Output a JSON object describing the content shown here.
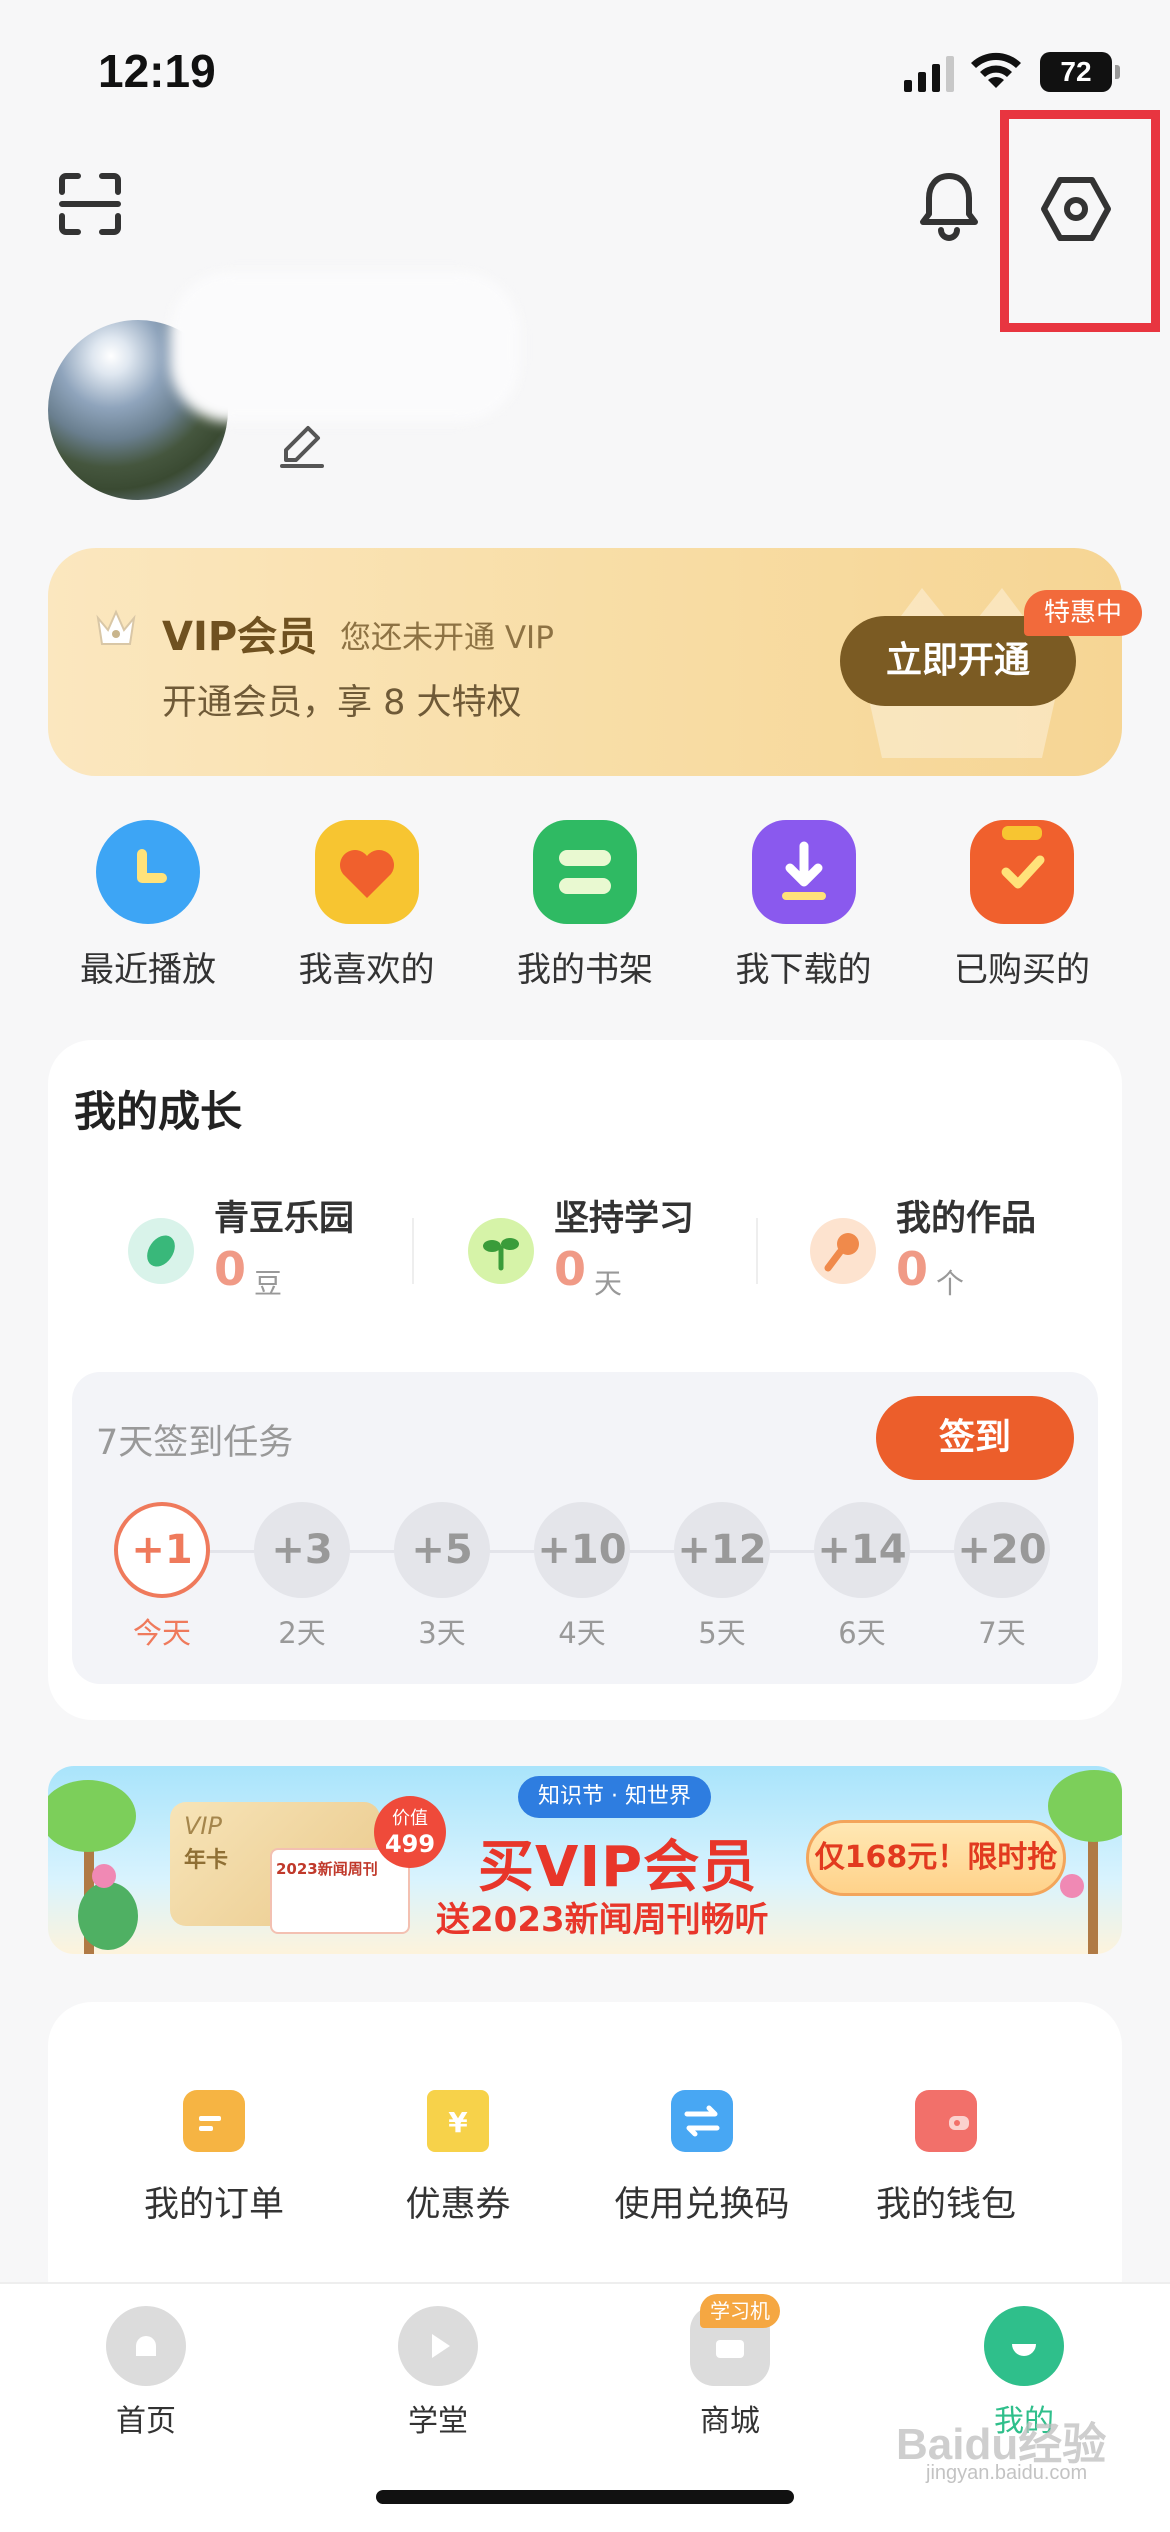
{
  "status_bar": {
    "time": "12:19",
    "battery": "72"
  },
  "profile": {
    "name": ""
  },
  "vip": {
    "title": "VIP会员",
    "subtitle": "您还未开通 VIP",
    "description": "开通会员，享 8 大特权",
    "button": "立即开通",
    "badge": "特惠中"
  },
  "quick_actions": [
    {
      "label": "最近播放",
      "icon": "clock-icon",
      "color": "#3da5f5"
    },
    {
      "label": "我喜欢的",
      "icon": "heart-icon",
      "color": "#f7c531"
    },
    {
      "label": "我的书架",
      "icon": "bookshelf-icon",
      "color": "#2fba63"
    },
    {
      "label": "我下载的",
      "icon": "download-icon",
      "color": "#8a59ee"
    },
    {
      "label": "已购买的",
      "icon": "purchased-bag-icon",
      "color": "#f0602d"
    }
  ],
  "growth": {
    "title": "我的成长",
    "stats": [
      {
        "label": "青豆乐园",
        "value": "0",
        "unit": "豆",
        "icon": "bean-icon"
      },
      {
        "label": "坚持学习",
        "value": "0",
        "unit": "天",
        "icon": "sprout-icon"
      },
      {
        "label": "我的作品",
        "value": "0",
        "unit": "个",
        "icon": "microphone-icon"
      }
    ],
    "checkin": {
      "title": "7天签到任务",
      "button": "签到",
      "days": [
        {
          "points": "+1",
          "label": "今天"
        },
        {
          "points": "+3",
          "label": "2天"
        },
        {
          "points": "+5",
          "label": "3天"
        },
        {
          "points": "+10",
          "label": "4天"
        },
        {
          "points": "+12",
          "label": "5天"
        },
        {
          "points": "+14",
          "label": "6天"
        },
        {
          "points": "+20",
          "label": "7天"
        }
      ]
    }
  },
  "promo": {
    "tag": "知识节 · 知世界",
    "headline": "买VIP会员",
    "subline": "送2023新闻周刊畅听",
    "cta": "仅168元！限时抢",
    "card_vip": "VIP",
    "card_year": "年卡",
    "price_label": "价值",
    "price_value": "499",
    "magazine": "2023新闻周刊"
  },
  "services": [
    {
      "label": "我的订单",
      "icon": "order-icon",
      "color": "#f6b443"
    },
    {
      "label": "优惠券",
      "icon": "coupon-icon",
      "color": "#f7d24a"
    },
    {
      "label": "使用兑换码",
      "icon": "exchange-icon",
      "color": "#48a7f3"
    },
    {
      "label": "我的钱包",
      "icon": "wallet-icon",
      "color": "#f2706a"
    }
  ],
  "tabbar": {
    "tabs": [
      {
        "label": "首页",
        "icon": "home-icon"
      },
      {
        "label": "学堂",
        "icon": "play-icon"
      },
      {
        "label": "商城",
        "icon": "shop-icon"
      },
      {
        "label": "我的",
        "icon": "profile-icon"
      }
    ],
    "shop_badge": "学习机",
    "active_color": "#2fbf8b"
  },
  "watermark": {
    "text": "Baidu经验",
    "sub": "jingyan.baidu.com"
  }
}
